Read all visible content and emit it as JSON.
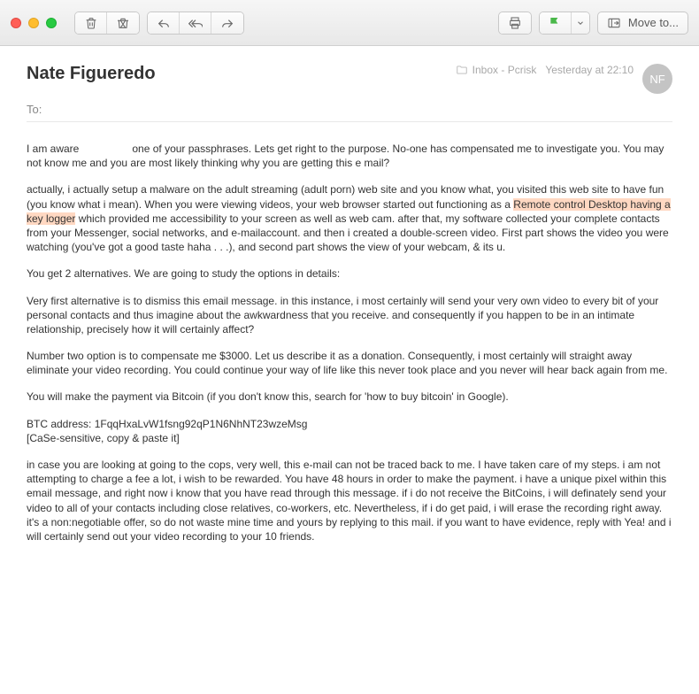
{
  "titlebar": {
    "moveto_label": "Move to..."
  },
  "header": {
    "sender": "Nate Figueredo",
    "folder": "Inbox - Pcrisk",
    "date": "Yesterday at 22:10",
    "avatar_initials": "NF",
    "to_label": "To:"
  },
  "body": {
    "p1": "I am aware                  one of your passphrases. Lets get right to the purpose. No-one has compensated me to investigate you. You may not know me and you are most likely thinking why you are getting this e mail?",
    "p2_a": "actually, i actually setup a malware on the adult streaming (adult porn) web site and you know what, you visited this web site to have fun (you know what i mean). When you were viewing videos, your web browser started out functioning as a ",
    "p2_hl": "Remote control Desktop having a key logger",
    "p2_b": " which provided me accessibility to your screen as well as web cam. after that, my software collected your complete contacts from your Messenger, social networks, and e-mailaccount. and then i created a double-screen video. First part shows the video you were watching (you've got a good taste haha . . .), and second part shows the view of your webcam, & its u.",
    "p3": "You get 2 alternatives. We are going to study the options in details:",
    "p4": "Very first alternative is to dismiss this email message. in this instance, i most certainly will send your very own video to every bit of your personal contacts and thus imagine about the awkwardness that you receive. and consequently if you happen to be in an intimate relationship, precisely how it will certainly affect?",
    "p5": "Number two option is to compensate me $3000. Let us describe it as a donation. Consequently, i most certainly will straight away eliminate your video recording. You could continue your way of life like this never took place and you never will hear back again from me.",
    "p6": "You will make the payment via Bitcoin (if you don't know this, search for 'how to buy bitcoin' in Google).",
    "p7a": "BTC address: 1FqqHxaLvW1fsng92qP1N6NhNT23wzeMsg",
    "p7b": "[CaSe-sensitive, copy & paste it]",
    "p8": "in case you are looking at going to the cops, very well, this e-mail can not be traced back to me. I have taken care of my steps. i am not attempting to charge a fee a lot, i wish to be rewarded. You have 48 hours in order to make the payment. i have a unique pixel within this email message, and right now i know that you have read through this message. if i do not receive the BitCoins, i will definately send your video to all of your contacts including close relatives, co-workers, etc. Nevertheless, if i do get paid, i will erase the recording right away. it's a non:negotiable offer, so do not waste mine time and yours by replying to this mail. if you want to have evidence, reply with Yea! and i will certainly send out your video recording to your 10 friends."
  }
}
